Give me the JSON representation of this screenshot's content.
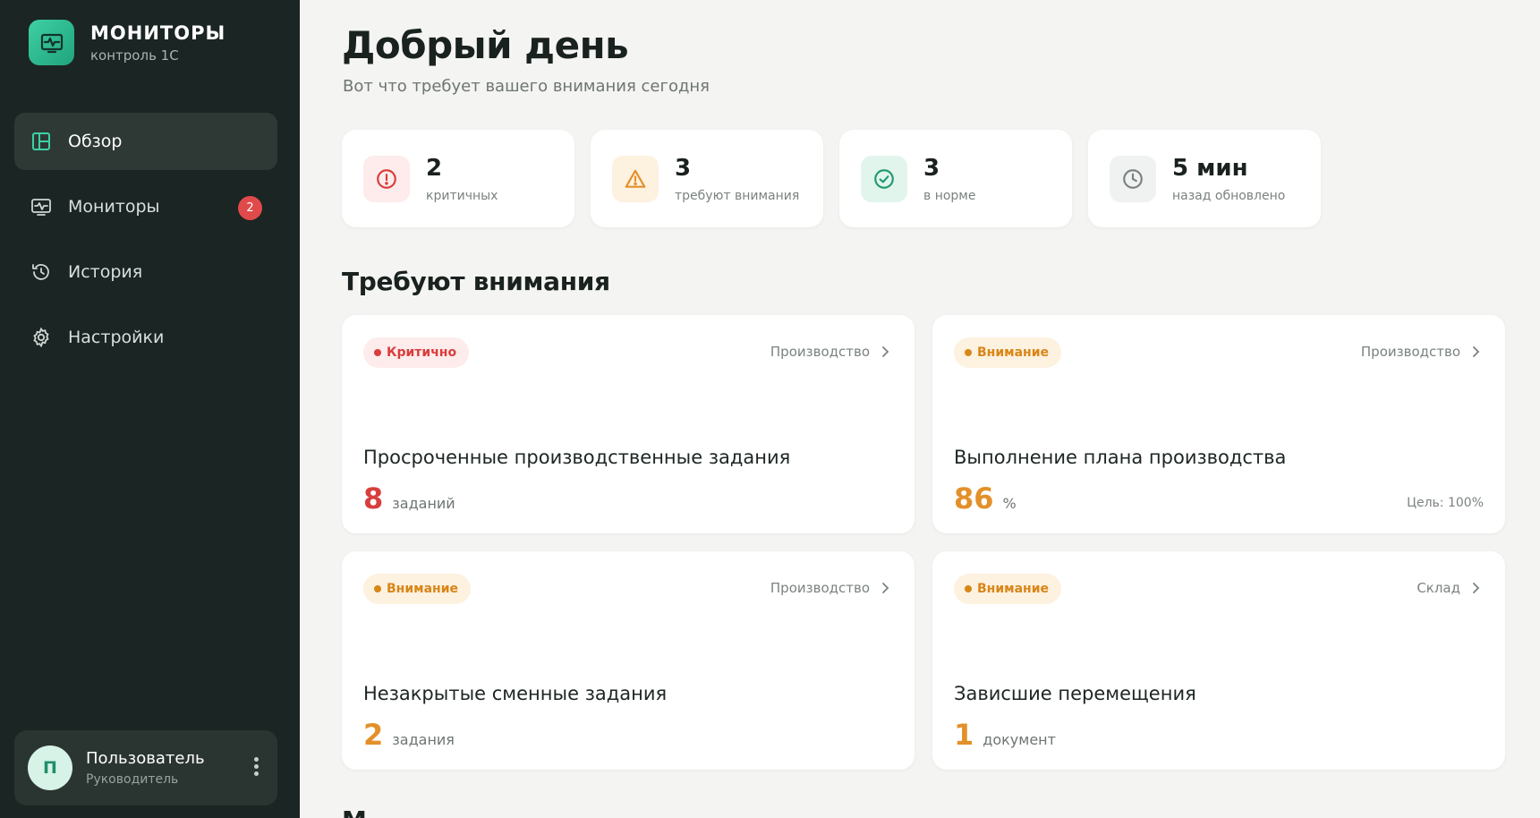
{
  "brand": {
    "title": "МОНИТОРЫ",
    "subtitle": "контроль 1С",
    "accent": "#2bbf92"
  },
  "nav": {
    "items": [
      {
        "label": "Обзор",
        "icon": "layout-icon",
        "active": true
      },
      {
        "label": "Мониторы",
        "icon": "monitor-icon",
        "badge": "2"
      },
      {
        "label": "История",
        "icon": "history-icon"
      },
      {
        "label": "Настройки",
        "icon": "gear-icon"
      }
    ]
  },
  "user": {
    "initial": "П",
    "name": "Пользователь",
    "role": "Руководитель"
  },
  "header": {
    "title": "Добрый день",
    "subtitle": "Вот что требует вашего внимания сегодня"
  },
  "stats": [
    {
      "value": "2",
      "label": "критичных",
      "icon": "alert-circle-icon",
      "color": "#d93d3d"
    },
    {
      "value": "3",
      "label": "требуют внимания",
      "icon": "warning-triangle-icon",
      "color": "#e3902a"
    },
    {
      "value": "3",
      "label": "в норме",
      "icon": "check-circle-icon",
      "color": "#1f9a72"
    },
    {
      "value": "5 мин",
      "label": "назад обновлено",
      "icon": "clock-icon",
      "color": "#7a8280"
    }
  ],
  "section": {
    "title": "Требуют внимания"
  },
  "cards": [
    {
      "status": "Критично",
      "category": "Производство",
      "title": "Просроченные производственные задания",
      "value": "8",
      "unit": "заданий"
    },
    {
      "status": "Внимание",
      "category": "Производство",
      "title": "Выполнение плана производства",
      "value": "86",
      "unit": "%",
      "goal": "Цель: 100%"
    },
    {
      "status": "Внимание",
      "category": "Производство",
      "title": "Незакрытые сменные задания",
      "value": "2",
      "unit": "задания"
    },
    {
      "status": "Внимание",
      "category": "Склад",
      "title": "Зависшие перемещения",
      "value": "1",
      "unit": "документ"
    }
  ],
  "next_section": {
    "title": "М"
  }
}
